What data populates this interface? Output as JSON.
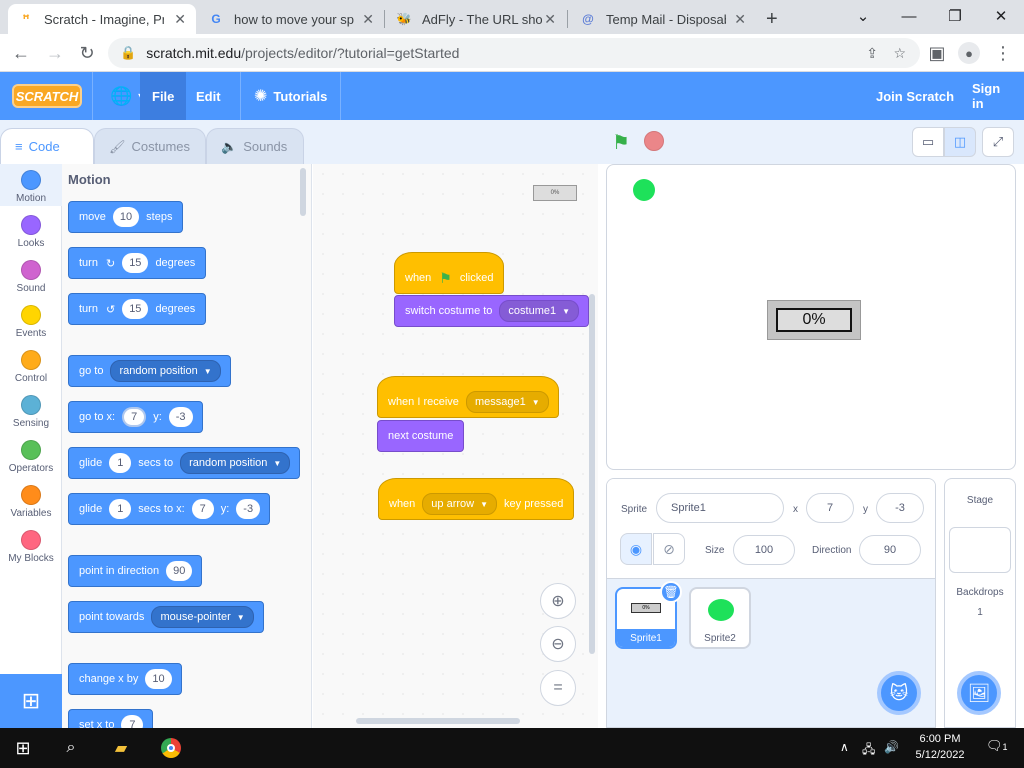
{
  "browser": {
    "tabs": [
      {
        "title": "Scratch - Imagine, Prog",
        "favicon": "S",
        "active": true
      },
      {
        "title": "how to move your sprit",
        "favicon": "G",
        "active": false
      },
      {
        "title": "AdFly - The URL shorte",
        "favicon": "bee",
        "active": false
      },
      {
        "title": "Temp Mail - Disposable",
        "favicon": "@",
        "active": false
      }
    ],
    "new_tab": "+",
    "url_host": "scratch.mit.edu",
    "url_path": "/projects/editor/?tutorial=getStarted"
  },
  "menubar": {
    "logo": "SCRATCH",
    "file": "File",
    "edit": "Edit",
    "tutorials": "Tutorials",
    "join": "Join Scratch",
    "signin": "Sign in"
  },
  "editor_tabs": {
    "code": "Code",
    "costumes": "Costumes",
    "sounds": "Sounds"
  },
  "categories": [
    {
      "label": "Motion",
      "color": "#4c97ff"
    },
    {
      "label": "Looks",
      "color": "#9966ff"
    },
    {
      "label": "Sound",
      "color": "#cf63cf"
    },
    {
      "label": "Events",
      "color": "#ffd500"
    },
    {
      "label": "Control",
      "color": "#ffab19"
    },
    {
      "label": "Sensing",
      "color": "#5cb1d6"
    },
    {
      "label": "Operators",
      "color": "#59c059"
    },
    {
      "label": "Variables",
      "color": "#ff8c1a"
    },
    {
      "label": "My Blocks",
      "color": "#ff6680"
    }
  ],
  "palette": {
    "title": "Motion",
    "move": {
      "a": "move",
      "n": "10",
      "b": "steps"
    },
    "turn_right": {
      "a": "turn",
      "n": "15",
      "b": "degrees"
    },
    "turn_left": {
      "a": "turn",
      "n": "15",
      "b": "degrees"
    },
    "goto": {
      "a": "go to",
      "opt": "random position"
    },
    "goto_xy": {
      "a": "go to x:",
      "x": "7",
      "b": "y:",
      "y": "-3"
    },
    "glide": {
      "a": "glide",
      "n": "1",
      "b": "secs to",
      "opt": "random position"
    },
    "glide_xy": {
      "a": "glide",
      "n": "1",
      "b": "secs to x:",
      "x": "7",
      "c": "y:",
      "y": "-3"
    },
    "point_dir": {
      "a": "point in direction",
      "n": "90"
    },
    "point_towards": {
      "a": "point towards",
      "opt": "mouse-pointer"
    },
    "change_x": {
      "a": "change x by",
      "n": "10"
    },
    "set_x": {
      "a": "set x to",
      "n": "7"
    }
  },
  "script": {
    "s1_hat_a": "when",
    "s1_hat_b": "clicked",
    "s1_switch": "switch costume to",
    "s1_costume": "costume1",
    "s2_hat": "when I receive",
    "s2_msg": "message1",
    "s2_next": "next costume",
    "s3_a": "when",
    "s3_key": "up arrow",
    "s3_b": "key pressed"
  },
  "stage": {
    "loader_text": "0%"
  },
  "sprite_info": {
    "sprite_label": "Sprite",
    "sprite_name": "Sprite1",
    "x_label": "x",
    "x": "7",
    "y_label": "y",
    "y": "-3",
    "size_label": "Size",
    "size": "100",
    "direction_label": "Direction",
    "direction": "90"
  },
  "sprites": [
    {
      "name": "Sprite1",
      "selected": true
    },
    {
      "name": "Sprite2",
      "selected": false
    }
  ],
  "thumb_loader_text": "0%",
  "stage_pane": {
    "title": "Stage",
    "backdrops_label": "Backdrops",
    "backdrops_count": "1"
  },
  "taskbar": {
    "time": "6:00 PM",
    "date": "5/12/2022",
    "notifications": "1"
  }
}
